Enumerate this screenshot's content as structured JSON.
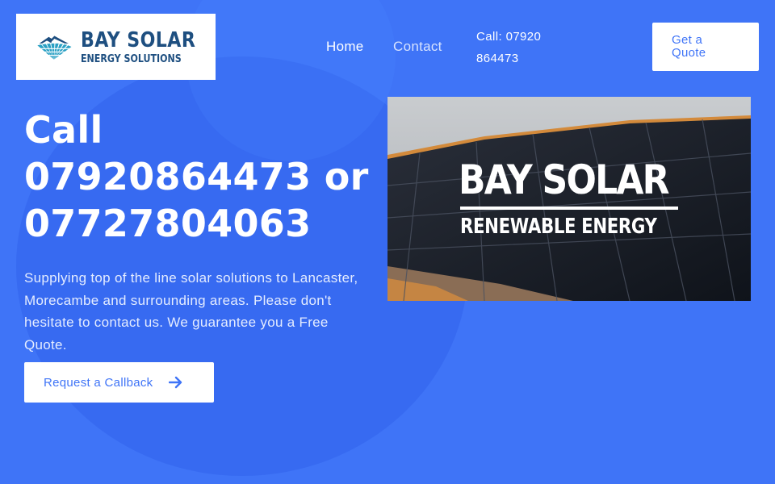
{
  "brand": {
    "name_line1": "BAY SOLAR",
    "name_line2": "ENERGY SOLUTIONS"
  },
  "nav": {
    "home": "Home",
    "contact": "Contact",
    "call": "Call: 07920 864473"
  },
  "header": {
    "quote_button": "Get a Quote"
  },
  "hero": {
    "headline": "Call 07920864473 or 07727804063",
    "description": "Supplying top of the line solar solutions to Lancaster, Morecambe and surrounding areas. Please don't hesitate to contact us. We guarantee you a Free Quote.",
    "callback_button": "Request a Callback",
    "image_text_line1": "BAY SOLAR",
    "image_text_line2": "RENEWABLE ENERGY"
  },
  "colors": {
    "background": "#3f74f7",
    "logo_navy": "#1e4f80",
    "logo_teal": "#2aa0c4"
  },
  "icons": [
    "solar-house-logo-icon",
    "arrow-right-icon"
  ]
}
